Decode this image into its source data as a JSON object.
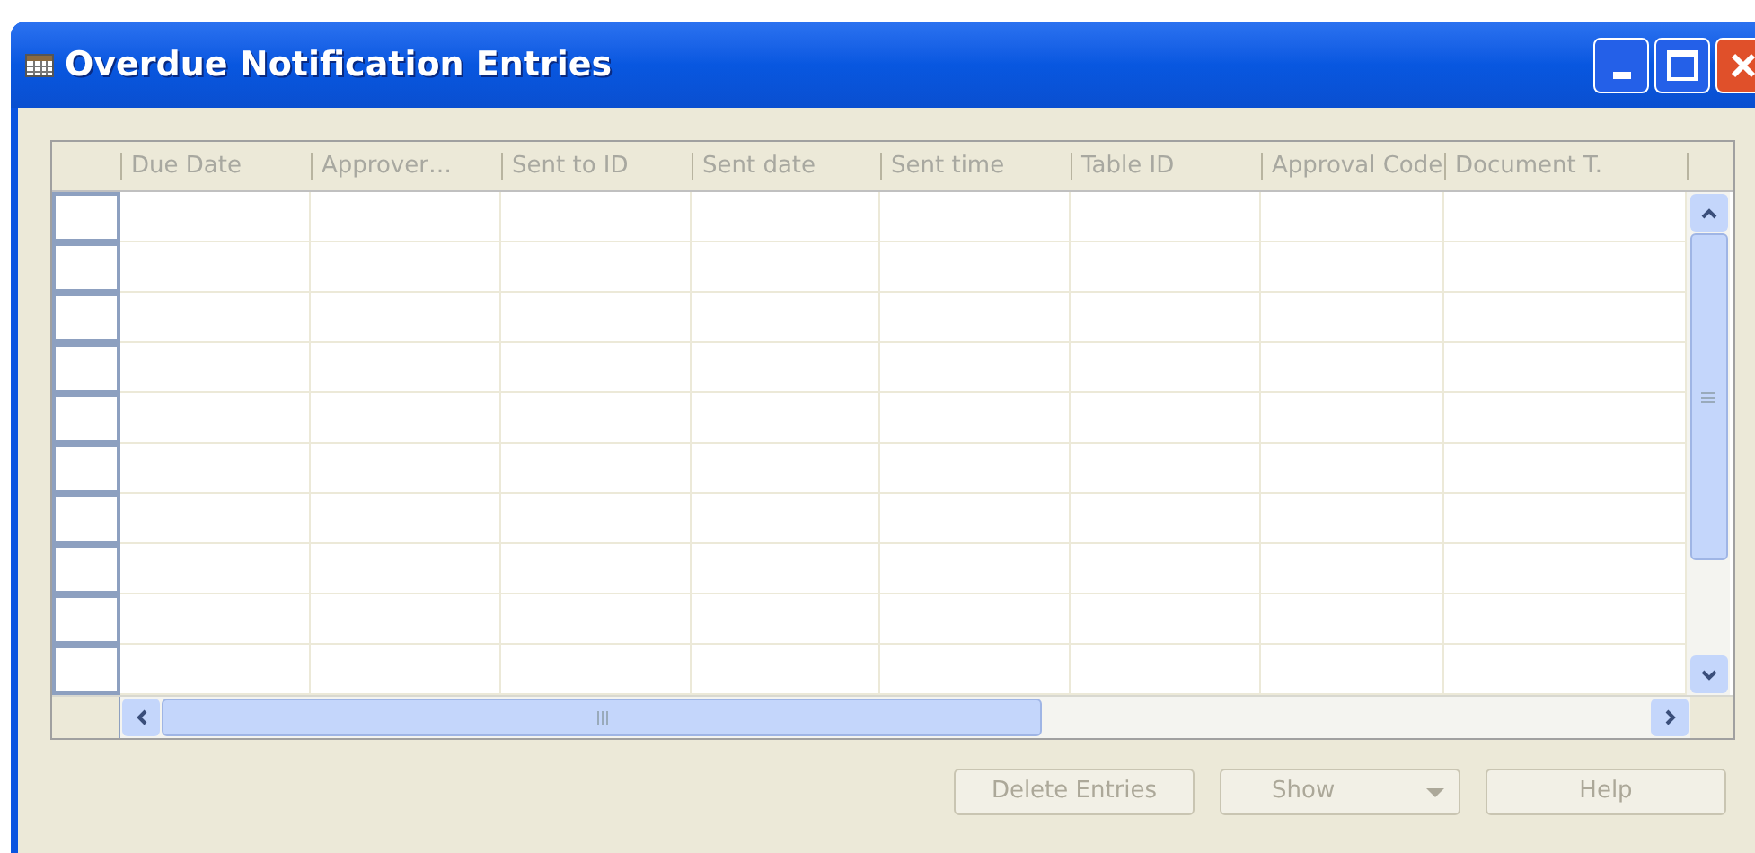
{
  "window": {
    "title": "Overdue Notification Entries"
  },
  "table": {
    "columns": [
      {
        "label": "Due Date"
      },
      {
        "label": "Approver…"
      },
      {
        "label": "Sent to ID"
      },
      {
        "label": "Sent date"
      },
      {
        "label": "Sent time"
      },
      {
        "label": "Table ID"
      },
      {
        "label": "Approval Code"
      },
      {
        "label": "Document T."
      }
    ]
  },
  "buttons": [
    {
      "label": "Delete Entries",
      "kind": "plain",
      "disabled": true
    },
    {
      "label": "Show",
      "kind": "dropdown",
      "disabled": true
    },
    {
      "label": "Help",
      "kind": "plain",
      "disabled": true
    }
  ]
}
